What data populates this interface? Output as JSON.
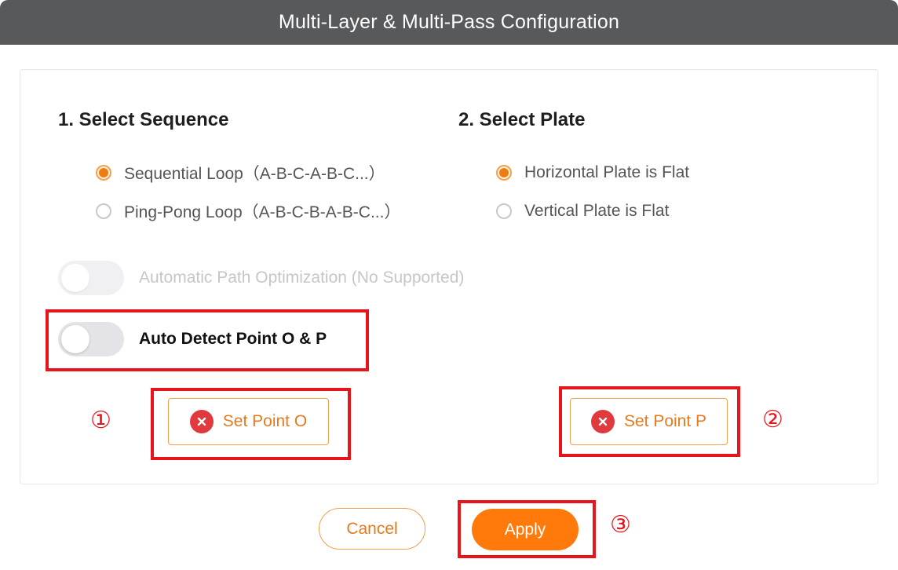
{
  "dialog": {
    "title": "Multi-Layer & Multi-Pass Configuration"
  },
  "sequence": {
    "heading": "1. Select Sequence",
    "options": [
      {
        "label": "Sequential Loop（A-B-C-A-B-C...）",
        "checked": true
      },
      {
        "label": "Ping-Pong Loop（A-B-C-B-A-B-C...）",
        "checked": false
      }
    ]
  },
  "plate": {
    "heading": "2. Select Plate",
    "options": [
      {
        "label": "Horizontal Plate is Flat",
        "checked": true
      },
      {
        "label": "Vertical Plate is Flat",
        "checked": false
      }
    ]
  },
  "toggles": {
    "path_optimization": {
      "label": "Automatic Path Optimization (No Supported)",
      "enabled": false,
      "disabled": true
    },
    "auto_detect": {
      "label": "Auto Detect Point O & P",
      "enabled": false,
      "disabled": false
    }
  },
  "points": {
    "set_o": "Set Point O",
    "set_p": "Set Point P"
  },
  "annotations": {
    "step1": "①",
    "step2": "②",
    "step3": "③",
    "color": "#e8141c"
  },
  "footer": {
    "cancel": "Cancel",
    "apply": "Apply"
  },
  "colors": {
    "accent": "#ff7a0a",
    "titlebar": "#58595b",
    "error": "#e03a3e"
  }
}
